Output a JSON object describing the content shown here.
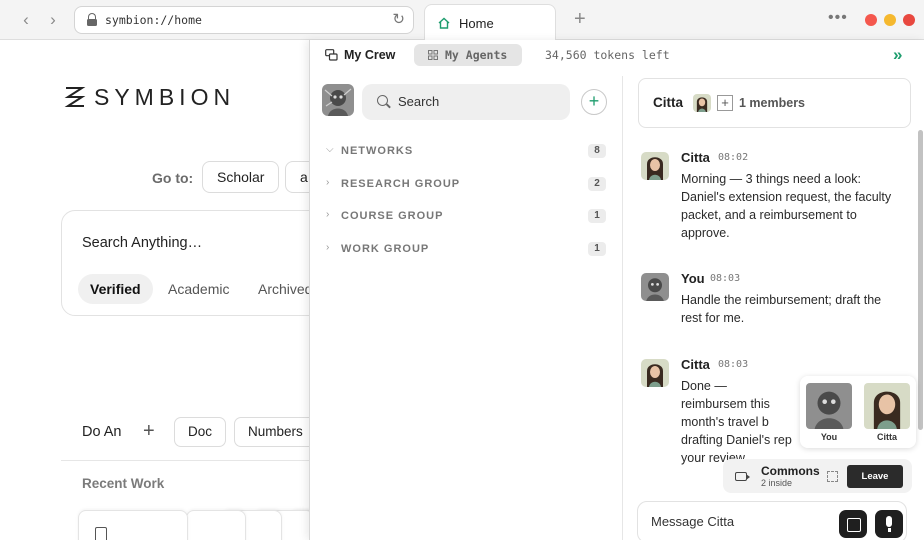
{
  "browser": {
    "url": "symbion://home",
    "tab_label": "Home"
  },
  "brand": {
    "wordmark": "SYMBION",
    "accent_color": "#1e9d6e"
  },
  "home": {
    "goto_label": "Go to:",
    "goto_items": [
      "Scholar",
      "a"
    ],
    "search_placeholder": "Search Anything…",
    "filters": [
      "Verified",
      "Academic",
      "Archived"
    ],
    "active_filter": "Verified",
    "do_an_label": "Do An",
    "do_an_items": [
      "Doc",
      "Numbers"
    ],
    "recent_label": "Recent Work"
  },
  "panel": {
    "crew_label": "My Crew",
    "agents_label": "My Agents",
    "tokens_left": "34,560 tokens left",
    "search_placeholder": "Search",
    "groups": [
      {
        "name": "NETWORKS",
        "count": "8",
        "expanded": true
      },
      {
        "name": "RESEARCH GROUP",
        "count": "2",
        "expanded": false
      },
      {
        "name": "COURSE GROUP",
        "count": "1",
        "expanded": false
      },
      {
        "name": "WORK GROUP",
        "count": "1",
        "expanded": false
      }
    ]
  },
  "chat": {
    "title": "Citta",
    "members": "1 members",
    "messages": [
      {
        "sender": "Citta",
        "time": "08:02",
        "text": "Morning — 3 things need a look: Daniel's extension request, the faculty packet, and a reimbursement to approve."
      },
      {
        "sender": "You",
        "time": "08:03",
        "text": "Handle the reimbursement; draft the rest for me."
      },
      {
        "sender": "Citta",
        "time": "08:03",
        "text": "Done — reimbursem this month's travel b drafting Daniel's rep your review."
      }
    ],
    "composer_placeholder": "Message Citta"
  },
  "call": {
    "participants": [
      "You",
      "Citta"
    ],
    "room_name": "Commons",
    "room_count": "2 inside",
    "leave_label": "Leave"
  }
}
